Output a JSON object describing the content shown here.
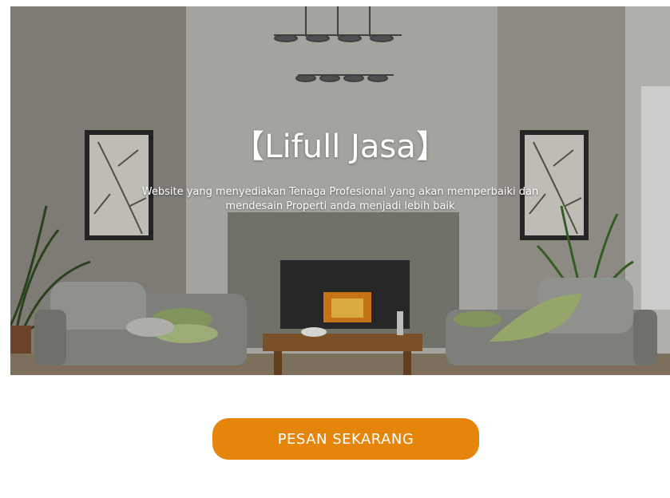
{
  "hero": {
    "title": "【Lifull Jasa】",
    "subtitle": "Website yang menyediakan Tenaga Profesional yang akan memperbaiki dan mendesain Properti anda menjadi lebih baik",
    "image_description_icon": "living-room-photo"
  },
  "cta": {
    "label": "PESAN SEKARANG"
  },
  "colors": {
    "accent": "#e5850b",
    "background": "#ffffff",
    "hero_text": "#ffffff"
  }
}
